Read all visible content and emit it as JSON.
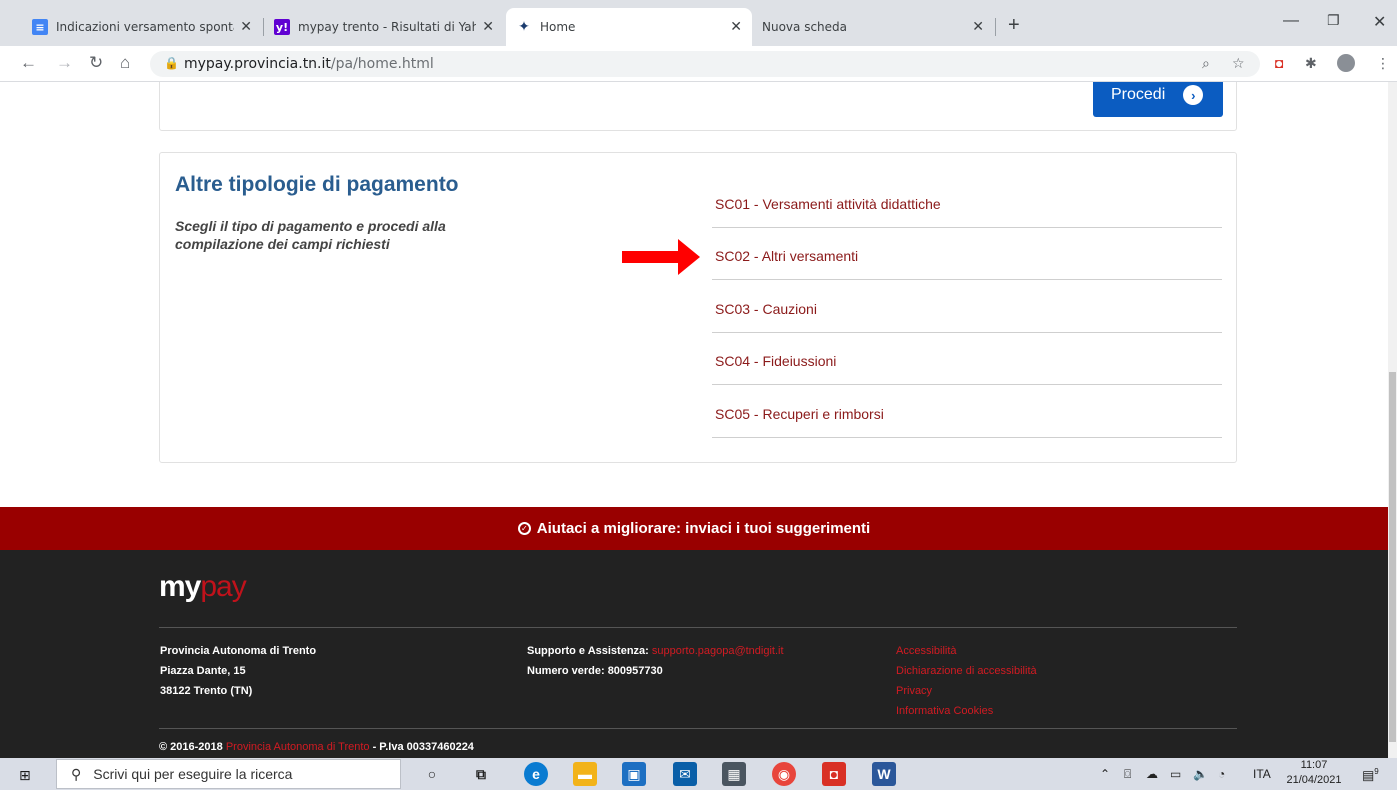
{
  "browser": {
    "tabs": [
      {
        "title": "Indicazioni versamento spontane",
        "favicon": "doc-icon",
        "active": false
      },
      {
        "title": "mypay trento - Risultati di Yahoo",
        "favicon": "yahoo-icon",
        "active": false
      },
      {
        "title": "Home",
        "favicon": "mypay-icon",
        "active": true
      },
      {
        "title": "Nuova scheda",
        "favicon": "",
        "active": false
      }
    ],
    "close_glyph": "✕",
    "new_tab": "+",
    "url_host": "mypay.provincia.tn.it",
    "url_path": "/pa/home.html"
  },
  "page": {
    "procedi_label": "Procedi",
    "section_title": "Altre tipologie di pagamento",
    "section_subtitle": "Scegli il tipo di pagamento e procedi alla compilazione dei campi richiesti",
    "payment_types": [
      "SC01 - Versamenti attività didattiche",
      "SC02 - Altri versamenti",
      "SC03 - Cauzioni",
      "SC04 - Fideiussioni",
      "SC05 - Recuperi e rimborsi"
    ],
    "highlighted_index": 1,
    "feedback_label": "Aiutaci a migliorare: inviaci i tuoi suggerimenti"
  },
  "footer": {
    "logo_my": "my",
    "logo_pay": "pay",
    "address": [
      "Provincia Autonoma di Trento",
      "Piazza Dante, 15",
      "38122 Trento (TN)"
    ],
    "support_label": "Supporto e Assistenza: ",
    "support_email": "supporto.pagopa@tndigit.it",
    "phone": "Numero verde: 800957730",
    "links": [
      "Accessibilità",
      "Dichiarazione di accessibilità",
      "Privacy",
      "Informativa Cookies"
    ],
    "copyright_prefix": "© 2016-2018 ",
    "copyright_link": "Provincia Autonoma di Trento",
    "copyright_suffix": " - P.Iva 00337460224"
  },
  "taskbar": {
    "search_placeholder": "Scrivi qui per eseguire la ricerca",
    "language": "ITA",
    "time": "11:07",
    "date": "21/04/2021",
    "notification_count": "9"
  },
  "colors": {
    "accent_blue": "#0b5cc1",
    "title_blue": "#2a5d8f",
    "link_red": "#8b1a1a",
    "feedback_bar": "#990000",
    "footer_bg": "#222222"
  }
}
